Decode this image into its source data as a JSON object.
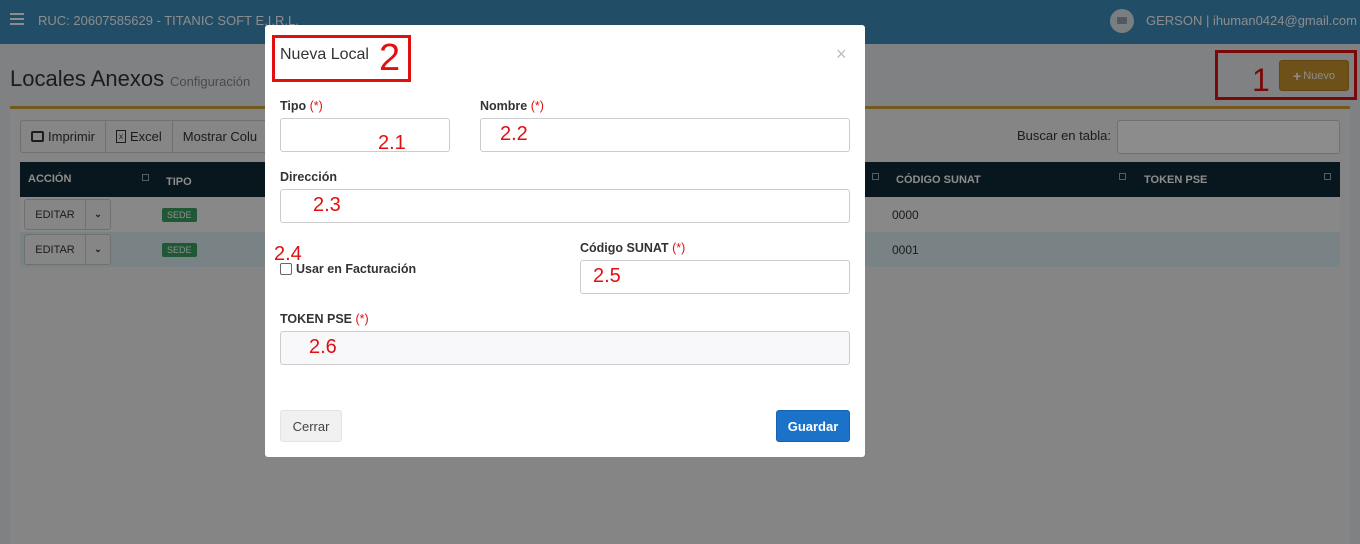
{
  "topbar": {
    "brand": "RUC: 20607585629 - TITANIC SOFT E.I.R.L.",
    "user": "GERSON | ihuman0424@gmail.com"
  },
  "page": {
    "title": "Locales Anexos",
    "subtitle": "Configuración",
    "new_button": "Nuevo"
  },
  "toolbar": {
    "print": "Imprimir",
    "excel": "Excel",
    "columns": "Mostrar Colu",
    "search_label": "Buscar en tabla:"
  },
  "table": {
    "headers": [
      "ACCIÓN",
      "TIPO",
      "CÓDIGO SUNAT",
      "TOKEN PSE"
    ],
    "rows": [
      {
        "action": "EDITAR",
        "tipo": "SEDE",
        "codigo": "0000"
      },
      {
        "action": "EDITAR",
        "tipo": "SEDE",
        "codigo": "0001"
      }
    ]
  },
  "modal": {
    "title": "Nueva Local",
    "close": "×",
    "required": "(*)",
    "fields": {
      "tipo": "Tipo",
      "nombre": "Nombre",
      "direccion": "Dirección",
      "facturacion": "Usar en Facturación",
      "codigo_sunat": "Código SUNAT",
      "token_pse": "TOKEN PSE"
    },
    "buttons": {
      "cerrar": "Cerrar",
      "guardar": "Guardar"
    }
  },
  "annotations": {
    "a1": "1",
    "a2": "2",
    "a21": "2.1",
    "a22": "2.2",
    "a23": "2.3",
    "a24": "2.4",
    "a25": "2.5",
    "a26": "2.6"
  },
  "colors": {
    "topbar": "#3c8dbc",
    "nuevo_button": "#c8922f",
    "table_header": "#0e2a35",
    "badge": "#3aa15f",
    "guardar_button": "#1a73c9",
    "annotation": "#e01010"
  }
}
